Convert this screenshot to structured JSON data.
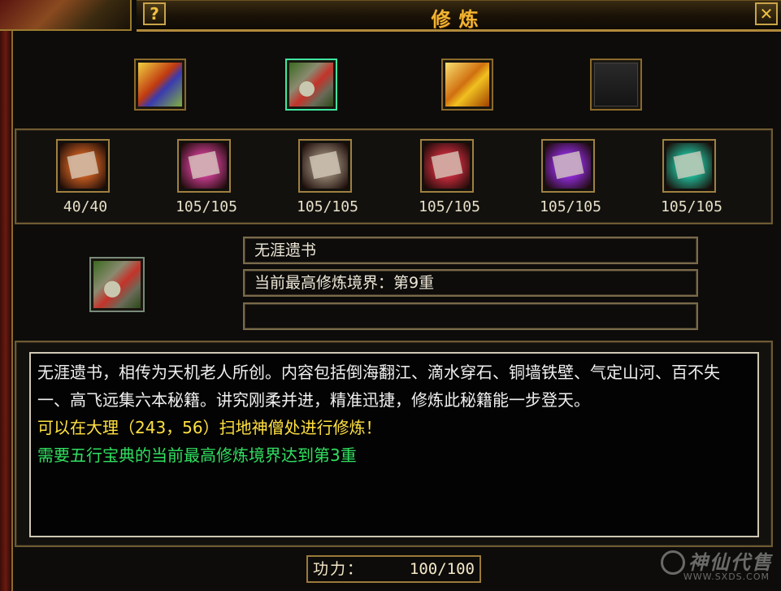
{
  "window": {
    "title": "修炼",
    "help_label": "?",
    "close_label": "✕"
  },
  "top_slots": [
    {
      "icon": "book-icon"
    },
    {
      "icon": "scroll-bundle-icon",
      "selected": true
    },
    {
      "icon": "gold-chest-icon"
    },
    {
      "icon": "empty-slot-icon"
    }
  ],
  "skills": [
    {
      "icon": "orange-scroll-icon",
      "count": "40/40",
      "color": "#c05a20"
    },
    {
      "icon": "pink-scroll-icon",
      "count": "105/105",
      "color": "#c03a8a"
    },
    {
      "icon": "silver-scroll-icon",
      "count": "105/105",
      "color": "#8a7a6a"
    },
    {
      "icon": "red-scroll-icon",
      "count": "105/105",
      "color": "#c02a3a"
    },
    {
      "icon": "purple-scroll-icon",
      "count": "105/105",
      "color": "#8a2ad0"
    },
    {
      "icon": "teal-scroll-icon",
      "count": "105/105",
      "color": "#20b090"
    }
  ],
  "selected_item": {
    "icon": "scroll-bundle-icon",
    "name": "无涯遗书",
    "realm": "当前最高修炼境界：第9重",
    "extra": ""
  },
  "description": {
    "text": "无涯遗书，相传为天机老人所创。内容包括倒海翻江、滴水穿石、铜墙铁壁、气定山河、百不失一、高飞远集六本秘籍。讲究刚柔并进，精准迅捷，修炼此秘籍能一步登天。",
    "location": "可以在大理（243，56）扫地神僧处进行修炼！",
    "requirement": "需要五行宝典的当前最高修炼境界达到第3重"
  },
  "power": {
    "label": "功力：",
    "value": "100/100"
  },
  "watermark": {
    "logo_text": "神仙代售",
    "url": "WWW.SXDS.COM"
  }
}
